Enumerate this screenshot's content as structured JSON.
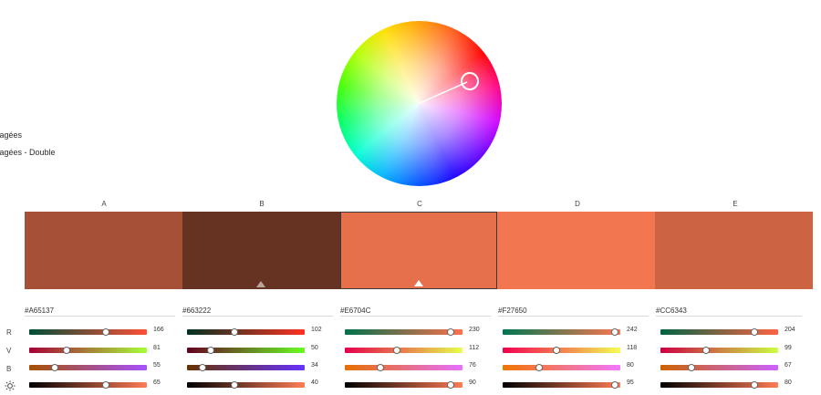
{
  "sidebar": {
    "options": [
      "rtagées",
      "rtagées - Double"
    ]
  },
  "wheel": {
    "handle_color": "#ffffff",
    "line_color": "#ffffff"
  },
  "columns": [
    {
      "letter": "A",
      "hex": "#A65137",
      "color": "#A65137",
      "values": [
        "166",
        "81",
        "55",
        "65"
      ],
      "fractions": [
        0.65,
        0.32,
        0.22,
        0.65
      ],
      "selected": false,
      "marker": false,
      "gradients": [
        "linear-gradient(90deg,#004e37,#ff4f37)",
        "linear-gradient(90deg,#a60037,#a6ff37)",
        "linear-gradient(90deg,#a65100,#a651ff)",
        "linear-gradient(90deg,#000000,#ff7c55)"
      ]
    },
    {
      "letter": "B",
      "hex": "#663222",
      "color": "#663222",
      "values": [
        "102",
        "50",
        "34",
        "40"
      ],
      "fractions": [
        0.4,
        0.2,
        0.13,
        0.4
      ],
      "selected": false,
      "marker": true,
      "marker_color": "#b9a39c",
      "gradients": [
        "linear-gradient(90deg,#003222,#ff3222)",
        "linear-gradient(90deg,#660022,#66ff22)",
        "linear-gradient(90deg,#663200,#6632ff)",
        "linear-gradient(90deg,#000000,#ff7d55)"
      ]
    },
    {
      "letter": "C",
      "hex": "#E6704C",
      "color": "#E6704C",
      "values": [
        "230",
        "112",
        "76",
        "90"
      ],
      "fractions": [
        0.9,
        0.44,
        0.3,
        0.9
      ],
      "selected": true,
      "marker": true,
      "marker_color": "#ffffff",
      "gradients": [
        "linear-gradient(90deg,#00704c,#ff704c)",
        "linear-gradient(90deg,#e6004c,#e6ff4c)",
        "linear-gradient(90deg,#e67000,#e670ff)",
        "linear-gradient(90deg,#000000,#ff7c54)"
      ]
    },
    {
      "letter": "D",
      "hex": "#F27650",
      "color": "#F27650",
      "values": [
        "242",
        "118",
        "80",
        "95"
      ],
      "fractions": [
        0.95,
        0.46,
        0.31,
        0.95
      ],
      "selected": false,
      "marker": false,
      "gradients": [
        "linear-gradient(90deg,#007650,#ff7650)",
        "linear-gradient(90deg,#f20050,#f2ff50)",
        "linear-gradient(90deg,#f27600,#f276ff)",
        "linear-gradient(90deg,#000000,#ff7c54)"
      ]
    },
    {
      "letter": "E",
      "hex": "#CC6343",
      "color": "#CC6343",
      "values": [
        "204",
        "99",
        "67",
        "80"
      ],
      "fractions": [
        0.8,
        0.39,
        0.26,
        0.8
      ],
      "selected": false,
      "marker": false,
      "gradients": [
        "linear-gradient(90deg,#006343,#ff6343)",
        "linear-gradient(90deg,#cc0043,#ccff43)",
        "linear-gradient(90deg,#cc6300,#cc63ff)",
        "linear-gradient(90deg,#000000,#ff7c53)"
      ]
    }
  ],
  "row_labels": [
    "R",
    "V",
    "B"
  ],
  "row_icon": "sun-icon"
}
